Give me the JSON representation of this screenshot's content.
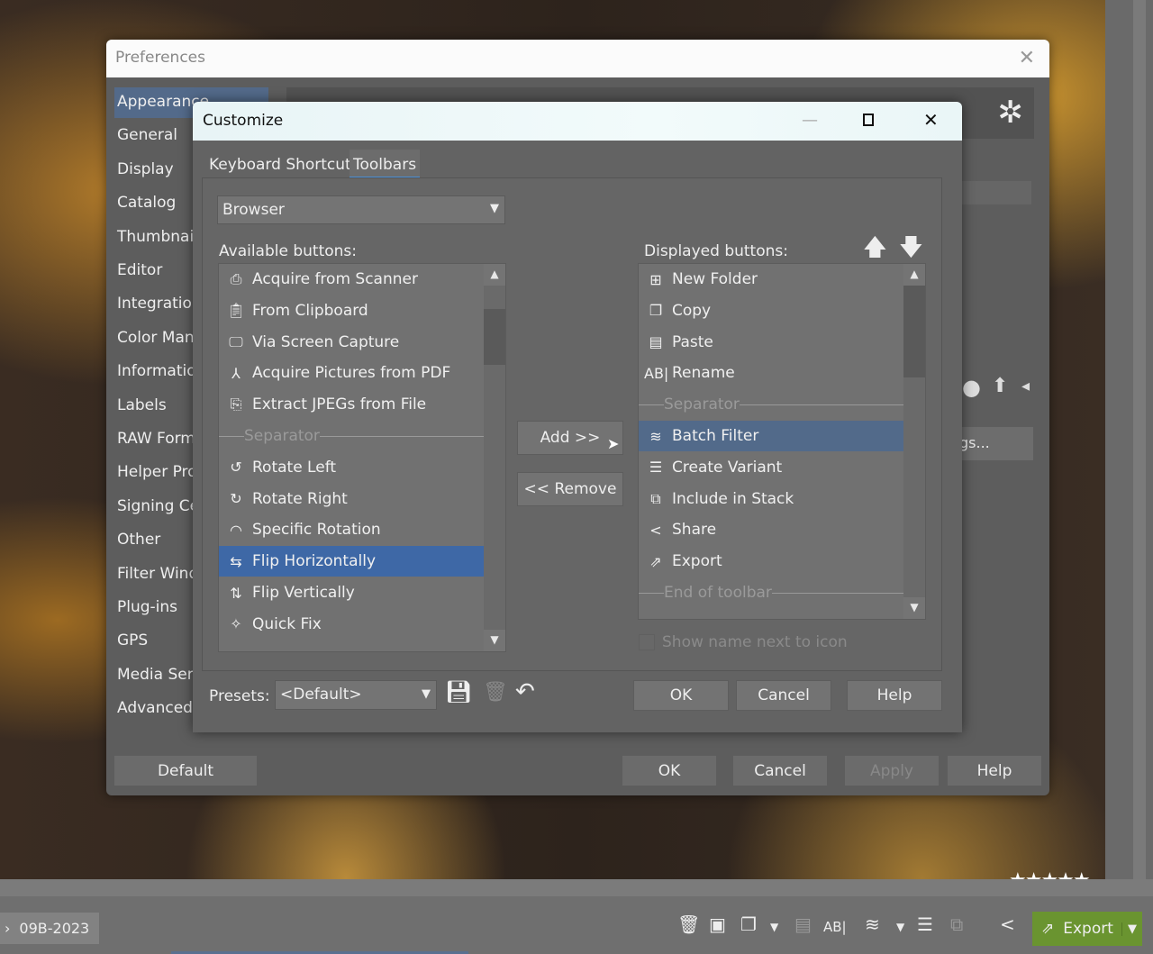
{
  "background": {
    "rating_stars": "★★★★★"
  },
  "bottom_bar": {
    "breadcrumb": "09B-2023",
    "export_label": "Export",
    "accent": "#6a9430"
  },
  "preferences": {
    "title": "Preferences",
    "sidebar": [
      "Appearance",
      "General",
      "Display",
      "Catalog",
      "Thumbnails",
      "Editor",
      "Integration",
      "Color Management",
      "Information",
      "Labels",
      "RAW Formats",
      "Helper Programs",
      "Signing Certificates",
      "Other",
      "Filter Window",
      "Plug-ins",
      "GPS",
      "Media Server",
      "Advanced"
    ],
    "partial_text": "gs...",
    "buttons": {
      "default": "Default",
      "ok": "OK",
      "cancel": "Cancel",
      "apply": "Apply",
      "help": "Help"
    }
  },
  "customize": {
    "title": "Customize",
    "tabs": [
      "Keyboard Shortcuts",
      "Toolbars"
    ],
    "toolbar_select": "Browser",
    "available_label": "Available buttons:",
    "displayed_label": "Displayed buttons:",
    "available": [
      {
        "icon": "scanner-icon",
        "label": "Acquire from Scanner"
      },
      {
        "icon": "clipboard-icon",
        "label": "From Clipboard"
      },
      {
        "icon": "screen-capture-icon",
        "label": "Via Screen Capture"
      },
      {
        "icon": "pdf-icon",
        "label": "Acquire Pictures from PDF"
      },
      {
        "icon": "extract-icon",
        "label": "Extract JPEGs from File"
      },
      {
        "separator": true,
        "label": "Separator"
      },
      {
        "icon": "rotate-left-icon",
        "label": "Rotate Left"
      },
      {
        "icon": "rotate-right-icon",
        "label": "Rotate Right"
      },
      {
        "icon": "rotation-icon",
        "label": "Specific Rotation"
      },
      {
        "icon": "flip-horizontal-icon",
        "label": "Flip Horizontally",
        "selected": true
      },
      {
        "icon": "flip-vertical-icon",
        "label": "Flip Vertically"
      },
      {
        "icon": "quick-fix-icon",
        "label": "Quick Fix"
      }
    ],
    "displayed": [
      {
        "icon": "new-folder-icon",
        "label": "New Folder"
      },
      {
        "icon": "copy-icon",
        "label": "Copy"
      },
      {
        "icon": "paste-icon",
        "label": "Paste"
      },
      {
        "icon": "rename-icon",
        "label": "Rename"
      },
      {
        "separator": true,
        "label": "Separator"
      },
      {
        "icon": "batch-filter-icon",
        "label": "Batch Filter",
        "selected": true
      },
      {
        "icon": "create-variant-icon",
        "label": "Create Variant"
      },
      {
        "icon": "stack-icon",
        "label": "Include in Stack"
      },
      {
        "icon": "share-icon",
        "label": "Share"
      },
      {
        "icon": "export-icon",
        "label": "Export"
      },
      {
        "separator": true,
        "label": "End of toolbar"
      }
    ],
    "add_label": "Add >>",
    "remove_label": "<< Remove",
    "show_name_label": "Show name next to icon",
    "show_name_checked": false,
    "presets_label": "Presets:",
    "preset_value": "<Default>",
    "buttons": {
      "ok": "OK",
      "cancel": "Cancel",
      "help": "Help"
    }
  }
}
